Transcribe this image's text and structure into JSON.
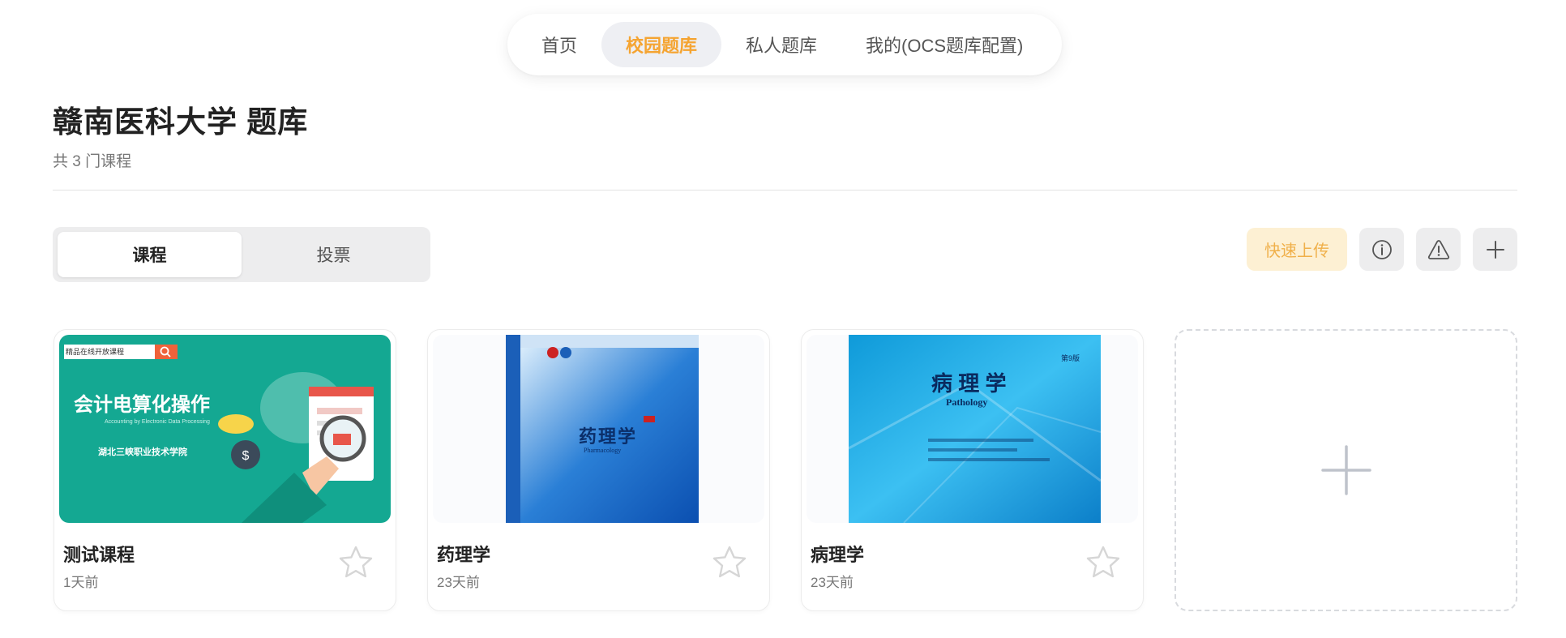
{
  "nav": {
    "items": [
      {
        "label": "首页"
      },
      {
        "label": "校园题库"
      },
      {
        "label": "私人题库"
      },
      {
        "label": "我的(OCS题库配置)"
      }
    ],
    "active_index": 1,
    "active_color": "#f5a431"
  },
  "header": {
    "title": "赣南医科大学 题库",
    "subtitle": "共 3 门课程"
  },
  "segment": {
    "tabs": [
      {
        "label": "课程"
      },
      {
        "label": "投票"
      }
    ],
    "active_index": 0
  },
  "actions": {
    "quick_upload_label": "快速上传",
    "icons": [
      "info-icon",
      "warning-icon",
      "plus-icon"
    ]
  },
  "courses": [
    {
      "name": "测试课程",
      "time": "1天前",
      "cover": {
        "badge": "精品在线开放课程",
        "title": "会计电算化操作",
        "subtitle": "Accounting by Electronic Data Processing",
        "school": "湖北三峡职业技术学院"
      }
    },
    {
      "name": "药理学",
      "time": "23天前",
      "cover": {
        "title": "药理学",
        "subtitle": "Pharmacology"
      }
    },
    {
      "name": "病理学",
      "time": "23天前",
      "cover": {
        "title": "病 理 学",
        "subtitle": "Pathology",
        "edition": "第9版"
      }
    }
  ],
  "colors": {
    "accent": "#f5a431",
    "upload_bg": "#fdf0d3",
    "cover_teal": "#14a892",
    "cover_blue": "#1aa3e8"
  }
}
